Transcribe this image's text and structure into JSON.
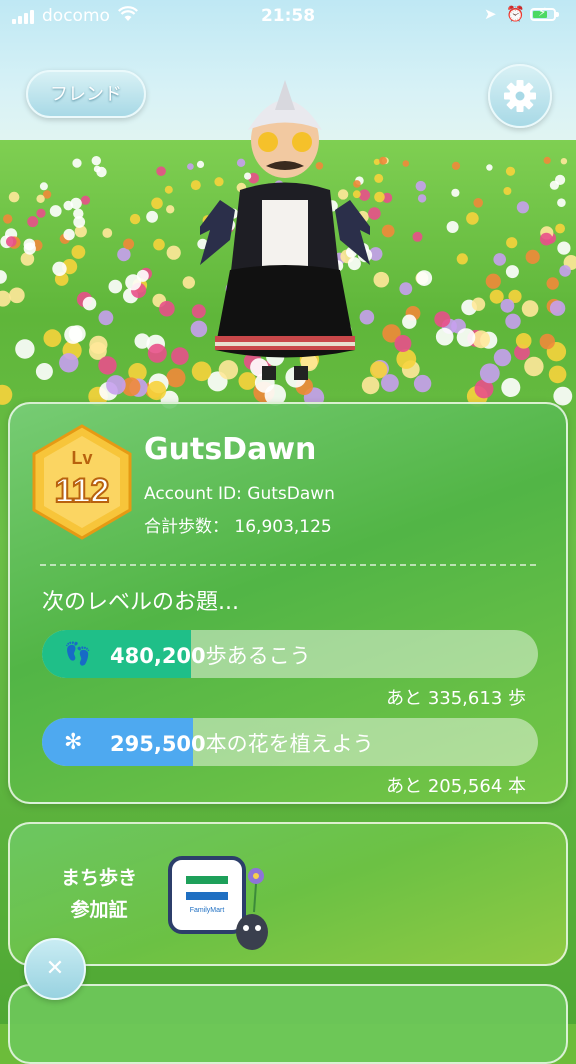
{
  "status_bar": {
    "carrier": "docomo",
    "time": "21:58"
  },
  "header": {
    "friend_button": "フレンド"
  },
  "profile": {
    "level_prefix": "Lv",
    "level": "112",
    "username": "GutsDawn",
    "account_id": "Account ID: GutsDawn",
    "total_steps": "合計歩数：  16,903,125"
  },
  "next_level": {
    "title": "次のレベルのお題...",
    "goals": [
      {
        "value": "480,200",
        "label": "歩あるこう",
        "remaining": "あと 335,613 歩",
        "progress": 0.301,
        "color": "#1fbf88"
      },
      {
        "value": "295,500",
        "label": "本の花を植えよう",
        "remaining": "あと 205,564 本",
        "progress": 0.304,
        "color": "#4ea9f0"
      }
    ]
  },
  "event_card": {
    "title_line1": "まち歩き",
    "title_line2": "参加証",
    "badge_text": "FamilyMart"
  },
  "colors": {
    "accent": "#5fb63a",
    "button_blue": "#a8d9e6",
    "level_gold": "#f2b632"
  }
}
